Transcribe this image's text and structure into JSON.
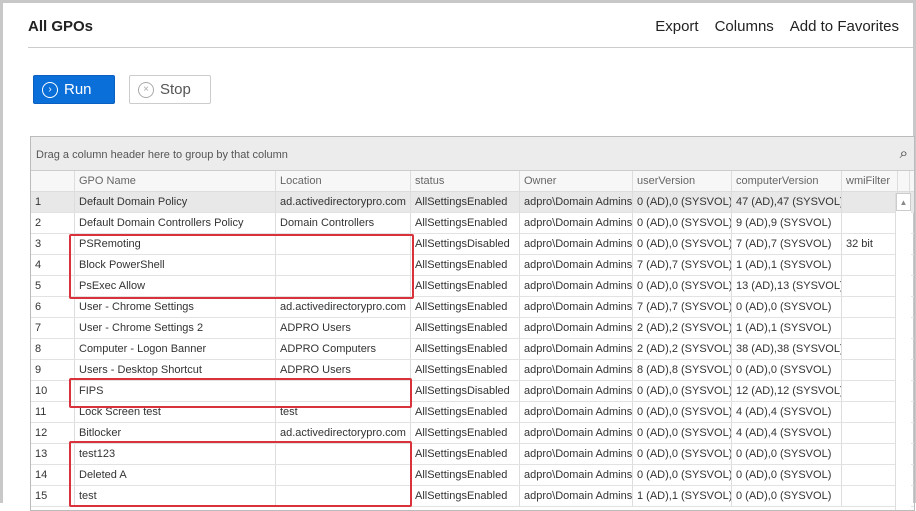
{
  "header": {
    "title": "All GPOs",
    "links": [
      "Export",
      "Columns",
      "Add to Favorites"
    ]
  },
  "toolbar": {
    "run_label": "Run",
    "stop_label": "Stop"
  },
  "grid": {
    "group_hint": "Drag a column header here to group by that column",
    "columns": [
      "",
      "GPO Name",
      "Location",
      "status",
      "Owner",
      "userVersion",
      "computerVersion",
      "wmiFilter",
      ""
    ],
    "rows": [
      [
        "1",
        "Default Domain Policy",
        "ad.activedirectorypro.com",
        "AllSettingsEnabled",
        "adpro\\Domain Admins",
        "0 (AD),0 (SYSVOL)",
        "47 (AD),47 (SYSVOL)",
        ""
      ],
      [
        "2",
        "Default Domain Controllers Policy",
        "Domain Controllers",
        "AllSettingsEnabled",
        "adpro\\Domain Admins",
        "0 (AD),0 (SYSVOL)",
        "9 (AD),9 (SYSVOL)",
        ""
      ],
      [
        "3",
        "PSRemoting",
        "",
        "AllSettingsDisabled",
        "adpro\\Domain Admins",
        "0 (AD),0 (SYSVOL)",
        "7 (AD),7 (SYSVOL)",
        "32 bit"
      ],
      [
        "4",
        "Block PowerShell",
        "",
        "AllSettingsEnabled",
        "adpro\\Domain Admins",
        "7 (AD),7 (SYSVOL)",
        "1 (AD),1 (SYSVOL)",
        ""
      ],
      [
        "5",
        "PsExec Allow",
        "",
        "AllSettingsEnabled",
        "adpro\\Domain Admins",
        "0 (AD),0 (SYSVOL)",
        "13 (AD),13 (SYSVOL)",
        ""
      ],
      [
        "6",
        "User - Chrome Settings",
        "ad.activedirectorypro.com",
        "AllSettingsEnabled",
        "adpro\\Domain Admins",
        "7 (AD),7 (SYSVOL)",
        "0 (AD),0 (SYSVOL)",
        ""
      ],
      [
        "7",
        "User - Chrome Settings 2",
        "ADPRO Users",
        "AllSettingsEnabled",
        "adpro\\Domain Admins",
        "2 (AD),2 (SYSVOL)",
        "1 (AD),1 (SYSVOL)",
        ""
      ],
      [
        "8",
        "Computer - Logon Banner",
        "ADPRO Computers",
        "AllSettingsEnabled",
        "adpro\\Domain Admins",
        "2 (AD),2 (SYSVOL)",
        "38 (AD),38 (SYSVOL)",
        ""
      ],
      [
        "9",
        "Users - Desktop Shortcut",
        "ADPRO Users",
        "AllSettingsEnabled",
        "adpro\\Domain Admins",
        "8 (AD),8 (SYSVOL)",
        "0 (AD),0 (SYSVOL)",
        ""
      ],
      [
        "10",
        "FIPS",
        "",
        "AllSettingsDisabled",
        "adpro\\Domain Admins",
        "0 (AD),0 (SYSVOL)",
        "12 (AD),12 (SYSVOL)",
        ""
      ],
      [
        "11",
        "Lock Screen test",
        "test",
        "AllSettingsEnabled",
        "adpro\\Domain Admins",
        "0 (AD),0 (SYSVOL)",
        "4 (AD),4 (SYSVOL)",
        ""
      ],
      [
        "12",
        "Bitlocker",
        "ad.activedirectorypro.com",
        "AllSettingsEnabled",
        "adpro\\Domain Admins",
        "0 (AD),0 (SYSVOL)",
        "4 (AD),4 (SYSVOL)",
        ""
      ],
      [
        "13",
        "test123",
        "",
        "AllSettingsEnabled",
        "adpro\\Domain Admins",
        "0 (AD),0 (SYSVOL)",
        "0 (AD),0 (SYSVOL)",
        ""
      ],
      [
        "14",
        "Deleted A",
        "",
        "AllSettingsEnabled",
        "adpro\\Domain Admins",
        "0 (AD),0 (SYSVOL)",
        "0 (AD),0 (SYSVOL)",
        ""
      ],
      [
        "15",
        "test",
        "",
        "AllSettingsEnabled",
        "adpro\\Domain Admins",
        "1 (AD),1 (SYSVOL)",
        "0 (AD),0 (SYSVOL)",
        ""
      ]
    ],
    "selected_row": 1
  },
  "colors": {
    "accent": "#0a6fd8",
    "highlight": "#d9323a"
  }
}
